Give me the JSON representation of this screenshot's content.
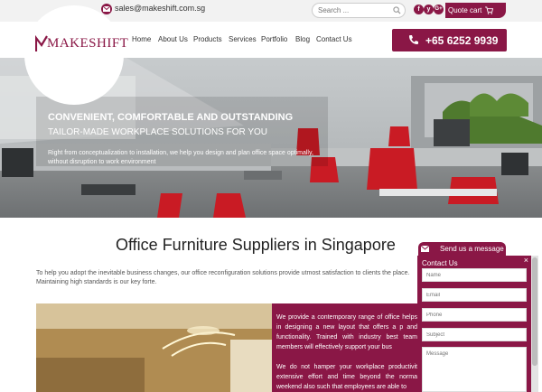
{
  "topbar": {
    "email": "sales@makeshift.com.sg",
    "search_placeholder": "Search ...",
    "social": [
      "f",
      "y",
      "G+"
    ],
    "quote_cart": "Quote cart",
    "icons": [
      "mail-icon",
      "search-icon",
      "facebook-icon",
      "twitter-icon",
      "google-plus-icon",
      "cart-icon"
    ]
  },
  "header": {
    "logo": "MAKESHIFT",
    "nav": [
      "Home",
      "About Us",
      "Products",
      "Services",
      "Portfolio",
      "Blog",
      "Contact Us"
    ],
    "phone": "+65 6252 9939"
  },
  "hero": {
    "headline": "CONVENIENT, COMFORTABLE AND OUTSTANDING",
    "subheadline": "TAILOR-MADE WORKPLACE SOLUTIONS FOR YOU",
    "text": "Right from conceptualization to installation, we help you design and plan office space optimally, without disruption to work environment"
  },
  "main": {
    "title": "Office Furniture Suppliers in Singapore",
    "intro": "To help you adopt the inevitable business changes, our office reconfiguration solutions provide utmost satisfaction to clients the place. Maintaining high standards is our key forte.",
    "maroon_p1": "We provide a contemporary range of office helps in designing a new layout that offers a p and functionality. Trained with industry best team members will effectively support your bus",
    "maroon_p2": "We do not hamper your workplace productivit extensive effort and time beyond the norma weekend also such that employees are able to"
  },
  "message_widget": {
    "tab_label": "Send us a message",
    "panel_title": "Contact Us",
    "placeholders": {
      "name": "Name",
      "email": "Email",
      "phone": "Phone",
      "subject": "Subject",
      "message": "Message"
    },
    "close": "×"
  },
  "colors": {
    "brand": "#8a1746",
    "topbar_bg": "#f2f2f2",
    "text_dark": "#222222"
  }
}
